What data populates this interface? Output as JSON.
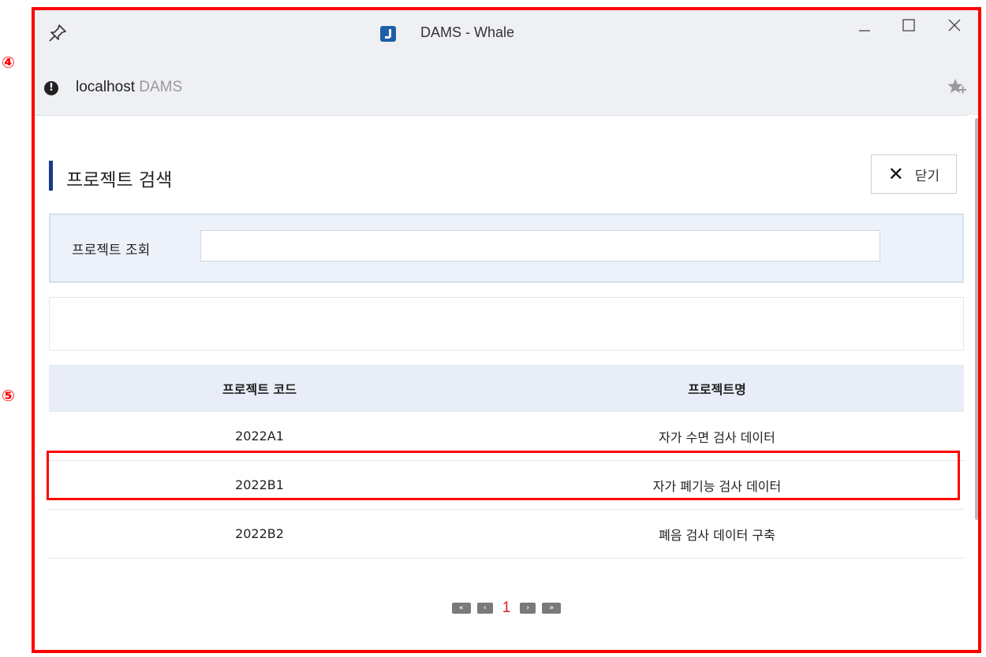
{
  "window": {
    "title": "DAMS - Whale"
  },
  "addressbar": {
    "host": "localhost",
    "path": "DAMS"
  },
  "page": {
    "title": "프로젝트 검색",
    "close_label": "닫기",
    "close_glyph": "✕"
  },
  "search": {
    "label": "프로젝트 조회",
    "value": "",
    "placeholder": ""
  },
  "table": {
    "headers": [
      "프로젝트 코드",
      "프로젝트명"
    ],
    "rows": [
      [
        "2022A1",
        "자가 수면 검사 데이터"
      ],
      [
        "2022B1",
        "자가 폐기능 검사 데이터"
      ],
      [
        "2022B2",
        "폐음 검사 데이터 구축"
      ]
    ]
  },
  "pagination": {
    "current_page": "1",
    "first_glyph": "«",
    "prev_glyph": "‹",
    "next_glyph": "›",
    "last_glyph": "»"
  },
  "annotations": {
    "marker_window": "④",
    "marker_table": "⑤",
    "color": "#ff0000"
  },
  "colors": {
    "accent": "#163a8c",
    "page_number": "#e02020"
  },
  "icons": {
    "pin": "pin-icon",
    "app": "whale-app-icon",
    "info": "info-icon",
    "favorite": "star-add-icon",
    "minimize": "minimize-icon",
    "maximize": "maximize-icon",
    "close": "close-icon"
  }
}
